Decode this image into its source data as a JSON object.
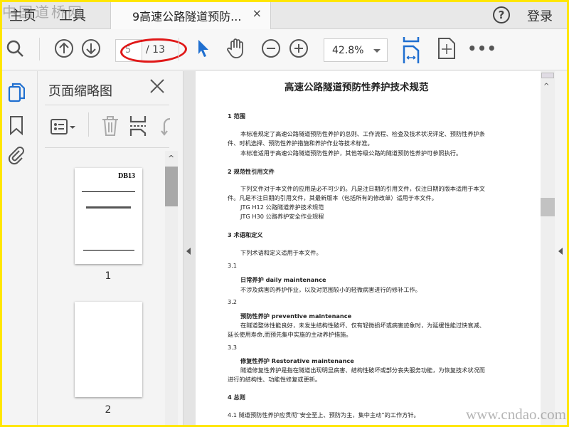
{
  "watermarks": {
    "top": "中国道桥网",
    "bottom": "www.cndao.com"
  },
  "tabs": {
    "home": "主页",
    "tools": "工具",
    "document": "9高速公路隧道预防...",
    "close": "×",
    "help": "?",
    "login": "登录"
  },
  "toolbar": {
    "page_current": "5",
    "page_total": "/ 13",
    "zoom": "42.8%"
  },
  "thumbnails": {
    "title": "页面缩略图",
    "pages": [
      {
        "label": "1",
        "code": "DB13"
      },
      {
        "label": "2"
      }
    ]
  },
  "document": {
    "title": "高速公路隧道预防性养护技术规范",
    "lines": [
      "1  范围",
      "本标准规定了高速公路隧道预防性养护的总则、工作流程、检查及技术状况评定、预防性养护条",
      "件、时机选择、预防性养护措施和养护作业等技术标准。",
      "本标准适用于高速公路隧道预防性养护，其他等级公路的隧道预防性养护可参照执行。",
      "2  规范性引用文件",
      "下列文件对于本文件的应用是必不可少的。凡是注日期的引用文件，仅注日期的版本适用于本文",
      "件。凡是不注日期的引用文件，其最新版本（包括所有的修改单）适用于本文件。",
      "JTG H12   公路隧道养护技术规范",
      "JTG H30   公路养护安全作业规程",
      "3  术语和定义",
      "下列术语和定义适用于本文件。",
      "3.1",
      "日常养护 daily maintenance",
      "不涉及病害的养护作业，以及对范围较小的轻微病害进行的修补工作。",
      "3.2",
      "预防性养护 preventive maintenance",
      "在隧道整体性能良好，未发生结构性破坏、仅有轻微损坏或病害迹象时，为延缓性能过快衰减、",
      "延长使用寿命,而预先集中实施的主动养护措施。",
      "3.3",
      "修复性养护 Restorative maintenance",
      "隧道修复性养护是指在隧道出现明显病害、结构性破坏或部分丧失服务功能，为恢复技术状况而",
      "进行的结构性、功能性修复或更新。",
      "4  总则",
      "4.1  隧道预防性养护应贯彻“安全至上、预防为主，集中主动”的工作方针。"
    ]
  }
}
